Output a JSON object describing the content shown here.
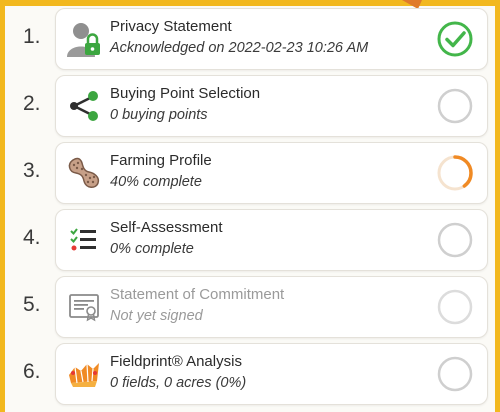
{
  "steps": [
    {
      "number": "1.",
      "title": "Privacy Statement",
      "subtitle": "Acknowledged on 2022-02-23 10:26 AM",
      "icon": "privacy-lock-user-icon",
      "status": "complete"
    },
    {
      "number": "2.",
      "title": "Buying Point Selection",
      "subtitle": "0 buying points",
      "icon": "share-icon",
      "status": "empty"
    },
    {
      "number": "3.",
      "title": "Farming Profile",
      "subtitle": "40% complete",
      "icon": "peanut-icon",
      "status": "partial",
      "progress": 0.4
    },
    {
      "number": "4.",
      "title": "Self-Assessment",
      "subtitle": "0% complete",
      "icon": "checklist-icon",
      "status": "empty",
      "progress": 0
    },
    {
      "number": "5.",
      "title": "Statement of Commitment",
      "subtitle": "Not yet signed",
      "icon": "certificate-icon",
      "status": "disabled"
    },
    {
      "number": "6.",
      "title": "Fieldprint® Analysis",
      "subtitle": "0 fields, 0 acres (0%)",
      "icon": "fieldprint-icon",
      "status": "empty"
    }
  ],
  "colors": {
    "accent": "#f2b81e",
    "complete": "#43b64a",
    "progress": "#f08a24",
    "empty": "#cfcfcf"
  }
}
